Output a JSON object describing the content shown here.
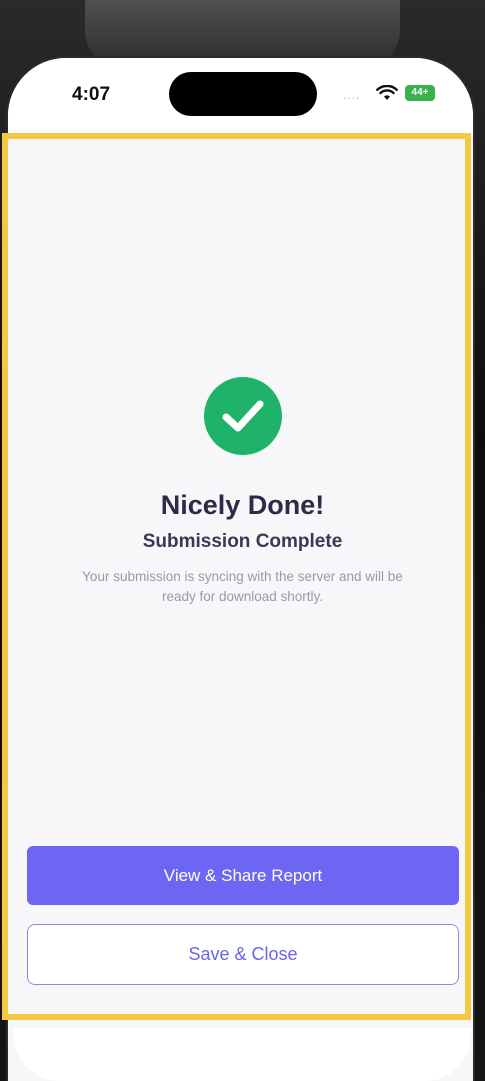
{
  "status_bar": {
    "time": "4:07",
    "signal": "....",
    "battery": "44+",
    "battery_color": "#38b24a",
    "wifi_icon": "wifi-icon"
  },
  "success": {
    "icon": "checkmark-circle-icon",
    "icon_color": "#1fb36a",
    "title": "Nicely Done!",
    "subtitle": "Submission Complete",
    "message": "Your submission is syncing with the server and will be ready for download shortly."
  },
  "actions": {
    "primary_label": "View & Share Report",
    "primary_color": "#6c66f2",
    "secondary_label": "Save & Close",
    "secondary_color": "#6a64e6"
  },
  "highlight_color": "#f5c842"
}
